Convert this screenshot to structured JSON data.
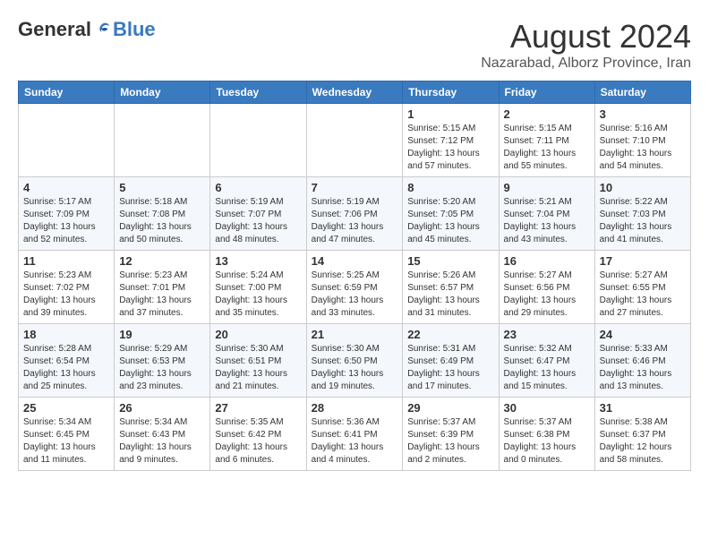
{
  "logo": {
    "general": "General",
    "blue": "Blue"
  },
  "title": {
    "month_year": "August 2024",
    "location": "Nazarabad, Alborz Province, Iran"
  },
  "days_of_week": [
    "Sunday",
    "Monday",
    "Tuesday",
    "Wednesday",
    "Thursday",
    "Friday",
    "Saturday"
  ],
  "weeks": [
    [
      {
        "day": "",
        "info": ""
      },
      {
        "day": "",
        "info": ""
      },
      {
        "day": "",
        "info": ""
      },
      {
        "day": "",
        "info": ""
      },
      {
        "day": "1",
        "info": "Sunrise: 5:15 AM\nSunset: 7:12 PM\nDaylight: 13 hours\nand 57 minutes."
      },
      {
        "day": "2",
        "info": "Sunrise: 5:15 AM\nSunset: 7:11 PM\nDaylight: 13 hours\nand 55 minutes."
      },
      {
        "day": "3",
        "info": "Sunrise: 5:16 AM\nSunset: 7:10 PM\nDaylight: 13 hours\nand 54 minutes."
      }
    ],
    [
      {
        "day": "4",
        "info": "Sunrise: 5:17 AM\nSunset: 7:09 PM\nDaylight: 13 hours\nand 52 minutes."
      },
      {
        "day": "5",
        "info": "Sunrise: 5:18 AM\nSunset: 7:08 PM\nDaylight: 13 hours\nand 50 minutes."
      },
      {
        "day": "6",
        "info": "Sunrise: 5:19 AM\nSunset: 7:07 PM\nDaylight: 13 hours\nand 48 minutes."
      },
      {
        "day": "7",
        "info": "Sunrise: 5:19 AM\nSunset: 7:06 PM\nDaylight: 13 hours\nand 47 minutes."
      },
      {
        "day": "8",
        "info": "Sunrise: 5:20 AM\nSunset: 7:05 PM\nDaylight: 13 hours\nand 45 minutes."
      },
      {
        "day": "9",
        "info": "Sunrise: 5:21 AM\nSunset: 7:04 PM\nDaylight: 13 hours\nand 43 minutes."
      },
      {
        "day": "10",
        "info": "Sunrise: 5:22 AM\nSunset: 7:03 PM\nDaylight: 13 hours\nand 41 minutes."
      }
    ],
    [
      {
        "day": "11",
        "info": "Sunrise: 5:23 AM\nSunset: 7:02 PM\nDaylight: 13 hours\nand 39 minutes."
      },
      {
        "day": "12",
        "info": "Sunrise: 5:23 AM\nSunset: 7:01 PM\nDaylight: 13 hours\nand 37 minutes."
      },
      {
        "day": "13",
        "info": "Sunrise: 5:24 AM\nSunset: 7:00 PM\nDaylight: 13 hours\nand 35 minutes."
      },
      {
        "day": "14",
        "info": "Sunrise: 5:25 AM\nSunset: 6:59 PM\nDaylight: 13 hours\nand 33 minutes."
      },
      {
        "day": "15",
        "info": "Sunrise: 5:26 AM\nSunset: 6:57 PM\nDaylight: 13 hours\nand 31 minutes."
      },
      {
        "day": "16",
        "info": "Sunrise: 5:27 AM\nSunset: 6:56 PM\nDaylight: 13 hours\nand 29 minutes."
      },
      {
        "day": "17",
        "info": "Sunrise: 5:27 AM\nSunset: 6:55 PM\nDaylight: 13 hours\nand 27 minutes."
      }
    ],
    [
      {
        "day": "18",
        "info": "Sunrise: 5:28 AM\nSunset: 6:54 PM\nDaylight: 13 hours\nand 25 minutes."
      },
      {
        "day": "19",
        "info": "Sunrise: 5:29 AM\nSunset: 6:53 PM\nDaylight: 13 hours\nand 23 minutes."
      },
      {
        "day": "20",
        "info": "Sunrise: 5:30 AM\nSunset: 6:51 PM\nDaylight: 13 hours\nand 21 minutes."
      },
      {
        "day": "21",
        "info": "Sunrise: 5:30 AM\nSunset: 6:50 PM\nDaylight: 13 hours\nand 19 minutes."
      },
      {
        "day": "22",
        "info": "Sunrise: 5:31 AM\nSunset: 6:49 PM\nDaylight: 13 hours\nand 17 minutes."
      },
      {
        "day": "23",
        "info": "Sunrise: 5:32 AM\nSunset: 6:47 PM\nDaylight: 13 hours\nand 15 minutes."
      },
      {
        "day": "24",
        "info": "Sunrise: 5:33 AM\nSunset: 6:46 PM\nDaylight: 13 hours\nand 13 minutes."
      }
    ],
    [
      {
        "day": "25",
        "info": "Sunrise: 5:34 AM\nSunset: 6:45 PM\nDaylight: 13 hours\nand 11 minutes."
      },
      {
        "day": "26",
        "info": "Sunrise: 5:34 AM\nSunset: 6:43 PM\nDaylight: 13 hours\nand 9 minutes."
      },
      {
        "day": "27",
        "info": "Sunrise: 5:35 AM\nSunset: 6:42 PM\nDaylight: 13 hours\nand 6 minutes."
      },
      {
        "day": "28",
        "info": "Sunrise: 5:36 AM\nSunset: 6:41 PM\nDaylight: 13 hours\nand 4 minutes."
      },
      {
        "day": "29",
        "info": "Sunrise: 5:37 AM\nSunset: 6:39 PM\nDaylight: 13 hours\nand 2 minutes."
      },
      {
        "day": "30",
        "info": "Sunrise: 5:37 AM\nSunset: 6:38 PM\nDaylight: 13 hours\nand 0 minutes."
      },
      {
        "day": "31",
        "info": "Sunrise: 5:38 AM\nSunset: 6:37 PM\nDaylight: 12 hours\nand 58 minutes."
      }
    ]
  ]
}
